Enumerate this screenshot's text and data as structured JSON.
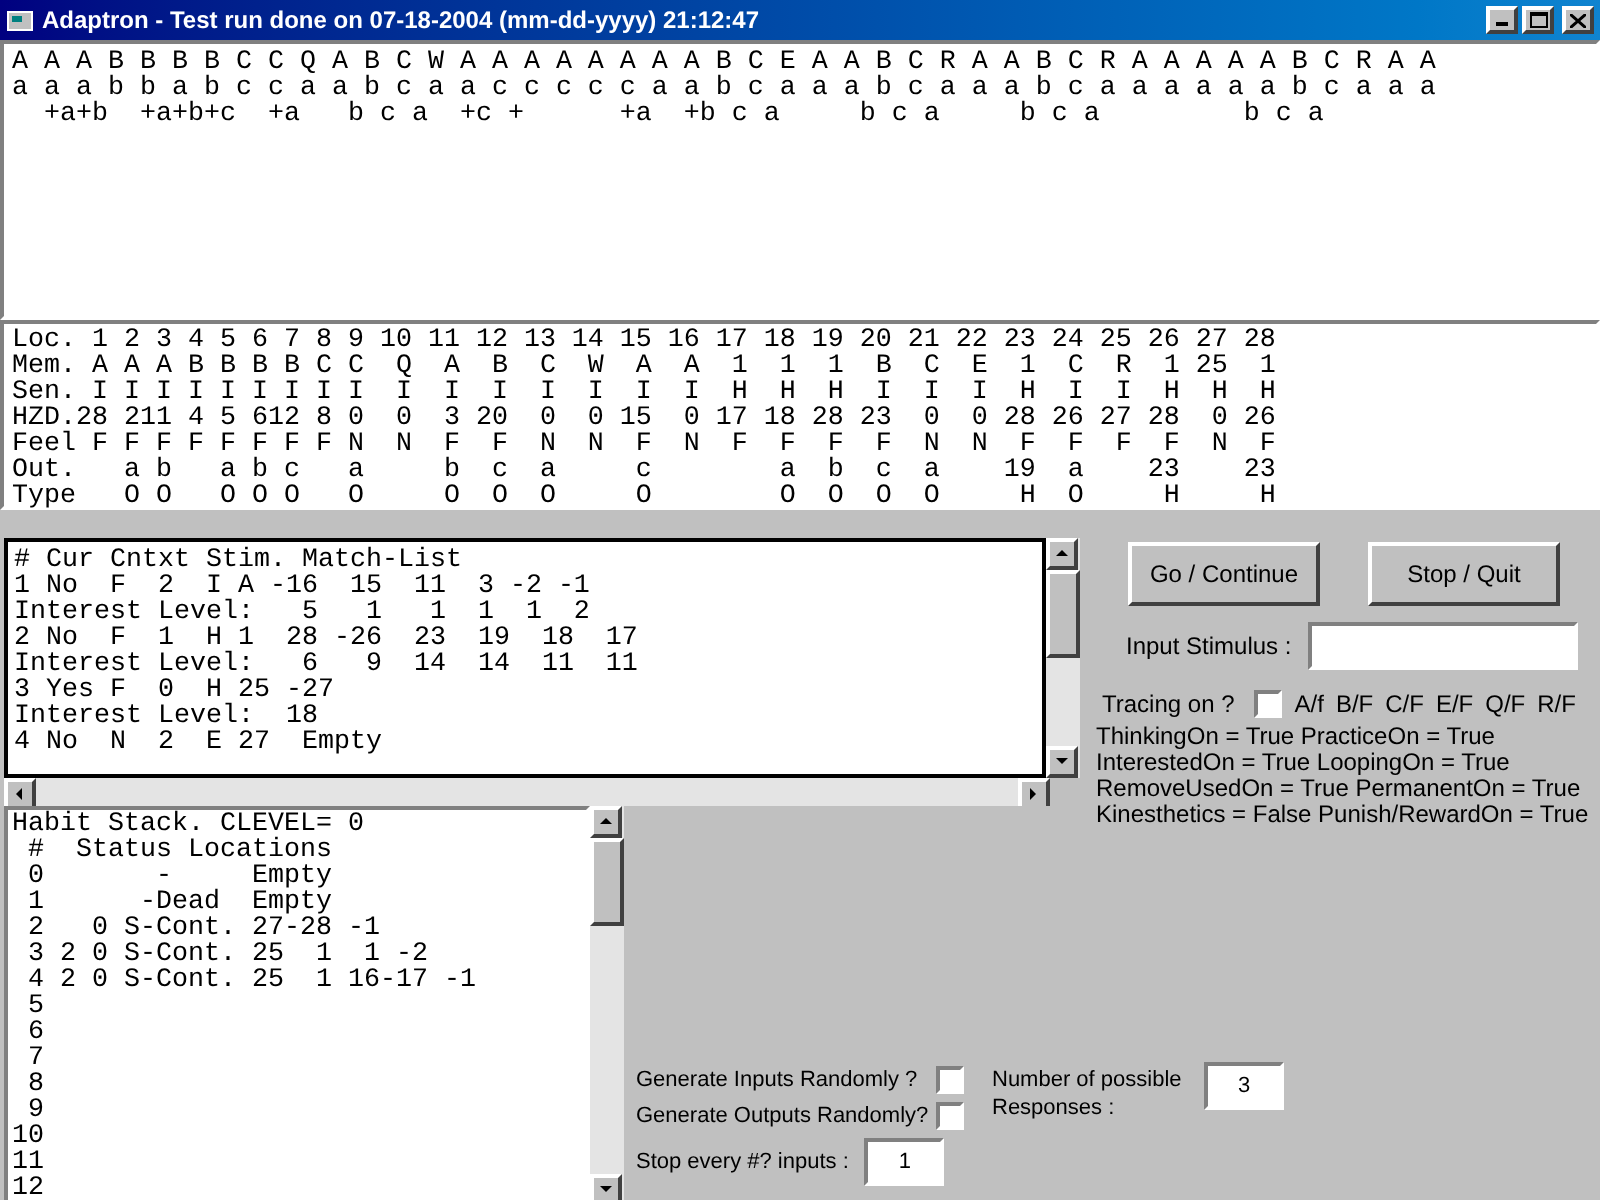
{
  "window": {
    "title": "Adaptron - Test run done on 07-18-2004 (mm-dd-yyyy) 21:12:47"
  },
  "sequence_display": {
    "lines": [
      "A A A B B B B C C Q A B C W A A A A A A A A B C E A A B C R A A B C R A A A A A B C R A A",
      "a a a b b a b c c a a b c a a c c c c c a a b c a a a b c a a a b c a a a a a a b c a a a",
      "  +a+b  +a+b+c  +a   b c a  +c +      +a  +b c a     b c a     b c a         b c a"
    ]
  },
  "memory_table": {
    "rows": [
      "Loc. 1 2 3 4 5 6 7 8 9 10 11 12 13 14 15 16 17 18 19 20 21 22 23 24 25 26 27 28",
      "Mem. A A A B B B B C C  Q  A  B  C  W  A  A  1  1  1  B  C  E  1  C  R  1 25  1",
      "Sen. I I I I I I I I I  I  I  I  I  I  I  I  H  H  H  I  I  I  H  I  I  H  H  H",
      "HZD.28 211 4 5 612 8 0  0  3 20  0  0 15  0 17 18 28 23  0  0 28 26 27 28  0 26",
      "Feel F F F F F F F F N  N  F  F  N  N  F  N  F  F  F  F  N  N  F  F  F  F  N  F",
      "Out.   a b   a b c   a     b  c  a     c        a  b  c  a    19  a    23    23",
      "Type   O O   O O O   O     O  O  O     O        O  O  O  O     H  O     H     H"
    ]
  },
  "context_list": {
    "lines": [
      "# Cur Cntxt Stim. Match-List",
      "1 No  F  2  I A -16  15  11  3 -2 -1",
      "Interest Level:   5   1   1  1  1  2",
      "2 No  F  1  H 1  28 -26  23  19  18  17",
      "Interest Level:   6   9  14  14  11  11",
      "3 Yes F  0  H 25 -27",
      "Interest Level:  18",
      "4 No  N  2  E 27  Empty"
    ]
  },
  "habit_stack": {
    "lines": [
      "Habit Stack. CLEVEL= 0",
      " #  Status Locations",
      " 0       -     Empty",
      " 1      -Dead  Empty",
      " 2   0 S-Cont. 27-28 -1",
      " 3 2 0 S-Cont. 25  1  1 -2",
      " 4 2 0 S-Cont. 25  1 16-17 -1",
      " 5",
      " 6",
      " 7",
      " 8",
      " 9",
      "10",
      "11",
      "12"
    ]
  },
  "buttons": [
    {
      "label": "Go / Continue"
    },
    {
      "label": "Stop / Quit"
    }
  ],
  "input_stimulus": {
    "label": "Input Stimulus :"
  },
  "tracing": {
    "label": "Tracing on ?",
    "checked": false,
    "options": [
      "A/f",
      "B/F",
      "C/F",
      "E/F",
      "Q/F",
      "R/F"
    ]
  },
  "settings_lines": [
    "ThinkingOn = True PracticeOn = True",
    "InterestedOn = True LoopingOn = True",
    "RemoveUsedOn = True PermanentOn = True",
    "Kinesthetics = False Punish/RewardOn = True"
  ],
  "random_options": [
    {
      "label": "Generate Inputs Randomly ?",
      "checked": false
    },
    {
      "label": "Generate Outputs Randomly?",
      "checked": false
    }
  ],
  "stop_every": {
    "label": "Stop every #? inputs :",
    "value": "1"
  },
  "responses": {
    "label": "Number of possible Responses :",
    "value": "3"
  }
}
